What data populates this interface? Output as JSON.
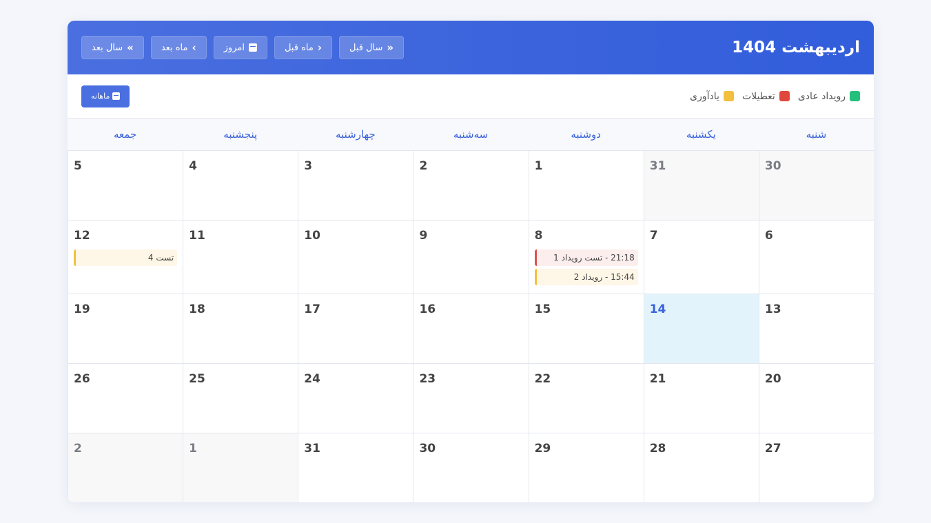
{
  "header": {
    "title": "اردیبهشت 1404",
    "nav": [
      {
        "label": "سال قبل",
        "icon": "double-chevron-left-icon",
        "glyph": "«"
      },
      {
        "label": "ماه قبل",
        "icon": "chevron-left-icon",
        "glyph": "‹"
      },
      {
        "label": "امروز",
        "icon": "calendar-icon",
        "glyph": ""
      },
      {
        "label": "ماه بعد",
        "icon": "chevron-right-icon",
        "glyph": "›"
      },
      {
        "label": "سال بعد",
        "icon": "double-chevron-right-icon",
        "glyph": "»"
      }
    ]
  },
  "toolbar": {
    "legend": [
      {
        "label": "رویداد عادی",
        "color": "#22c07a"
      },
      {
        "label": "تعطیلات",
        "color": "#e0483e"
      },
      {
        "label": "یادآوری",
        "color": "#f2c03c"
      }
    ],
    "view_label": "ماهانه"
  },
  "weekdays": [
    "شنبه",
    "یکشنبه",
    "دوشنبه",
    "سه‌شنبه",
    "چهارشنبه",
    "پنجشنبه",
    "جمعه"
  ],
  "weeks": [
    [
      {
        "num": "30",
        "outside": true
      },
      {
        "num": "31",
        "outside": true
      },
      {
        "num": "1"
      },
      {
        "num": "2"
      },
      {
        "num": "3"
      },
      {
        "num": "4"
      },
      {
        "num": "5"
      }
    ],
    [
      {
        "num": "6"
      },
      {
        "num": "7"
      },
      {
        "num": "8",
        "events": [
          {
            "text": "21:18 - تست رویداد 1",
            "type": "holiday"
          },
          {
            "text": "15:44 - رویداد 2",
            "type": "reminder"
          }
        ]
      },
      {
        "num": "9"
      },
      {
        "num": "10"
      },
      {
        "num": "11"
      },
      {
        "num": "12",
        "events": [
          {
            "text": "تست 4",
            "type": "reminder"
          }
        ]
      }
    ],
    [
      {
        "num": "13"
      },
      {
        "num": "14",
        "today": true
      },
      {
        "num": "15"
      },
      {
        "num": "16"
      },
      {
        "num": "17"
      },
      {
        "num": "18"
      },
      {
        "num": "19"
      }
    ],
    [
      {
        "num": "20"
      },
      {
        "num": "21"
      },
      {
        "num": "22"
      },
      {
        "num": "23"
      },
      {
        "num": "24"
      },
      {
        "num": "25"
      },
      {
        "num": "26"
      }
    ],
    [
      {
        "num": "27"
      },
      {
        "num": "28"
      },
      {
        "num": "29"
      },
      {
        "num": "30"
      },
      {
        "num": "31"
      },
      {
        "num": "1",
        "outside": true
      },
      {
        "num": "2",
        "outside": true
      }
    ]
  ]
}
